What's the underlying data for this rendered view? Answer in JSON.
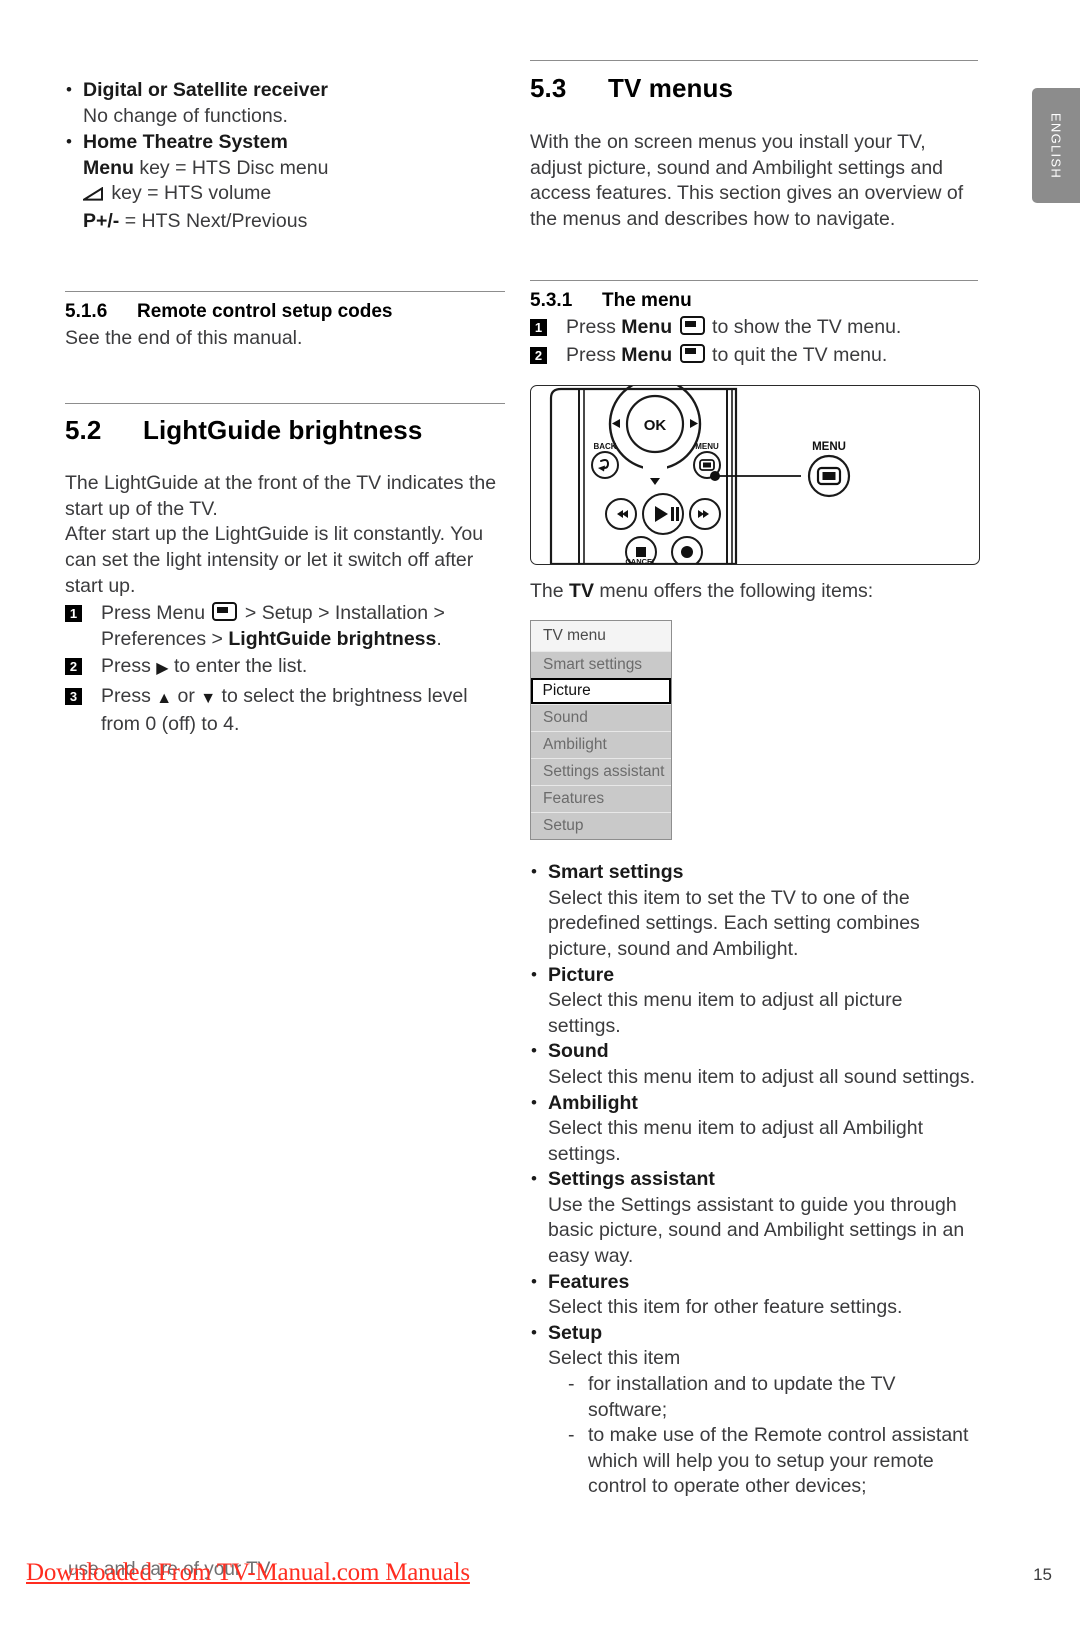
{
  "language_tab": {
    "label": "ENGLISH"
  },
  "left_column": {
    "device_bullets": [
      {
        "term": "Digital or Satellite receiver",
        "lines": [
          "No change of functions."
        ]
      },
      {
        "term": "Home Theatre System",
        "lines": []
      }
    ],
    "hts_lines": [
      {
        "bold": "Menu",
        "rest": " key = HTS Disc menu"
      },
      {
        "icon": "volume-icon",
        "rest": " key = HTS volume"
      },
      {
        "bold": "P+/-",
        "rest": " = HTS Next/Previous"
      }
    ],
    "section_516": {
      "number": "5.1.6",
      "title": "Remote control setup codes",
      "body": "See the end of this manual."
    },
    "section_52": {
      "number": "5.2",
      "title": "LightGuide brightness",
      "paragraphs": [
        "The LightGuide at the front of the TV indicates the start up of the TV.",
        "After start up the LightGuide is lit constantly. You can set the light intensity or let it switch off after start up."
      ],
      "steps": [
        {
          "num": "1",
          "pre": "Press Menu ",
          "post_a": " > Setup > Installation > Preferences > ",
          "bold_tail": "LightGuide brightness",
          "post_b": "."
        },
        {
          "num": "2",
          "text_a": "Press ",
          "arrow": "▶",
          "text_b": " to enter the list."
        },
        {
          "num": "3",
          "text_a": "Press ",
          "arrow_up": "▲",
          "text_mid": " or ",
          "arrow_down": "▼",
          "text_b": " to select the brightness level from 0 (off) to 4."
        }
      ]
    }
  },
  "right_column": {
    "section_53": {
      "number": "5.3",
      "title": "TV menus",
      "intro": "With the on screen menus you install your TV, adjust picture, sound and Ambilight settings and access features. This section gives an overview of the menus and describes how to navigate."
    },
    "section_531": {
      "number": "5.3.1",
      "title": "The menu",
      "steps": [
        {
          "num": "1",
          "pre": "Press ",
          "bold": "Menu",
          "post": " to show the TV menu."
        },
        {
          "num": "2",
          "pre": "Press ",
          "bold": "Menu",
          "post": " to quit the TV menu."
        }
      ]
    },
    "remote_figure": {
      "ok_label": "OK",
      "back_label": "BACK",
      "menu_label": "MENU",
      "callout_label": "MENU",
      "cancel_label": "CANCEL"
    },
    "menu_intro_pre": "The ",
    "menu_intro_bold": "TV",
    "menu_intro_post": " menu offers the following items:",
    "tv_menu": {
      "title": "TV menu",
      "items": [
        {
          "label": "Smart settings",
          "selected": false
        },
        {
          "label": "Picture",
          "selected": true
        },
        {
          "label": "Sound",
          "selected": false
        },
        {
          "label": "Ambilight",
          "selected": false
        },
        {
          "label": "Settings assistant",
          "selected": false
        },
        {
          "label": "Features",
          "selected": false
        },
        {
          "label": "Setup",
          "selected": false
        }
      ]
    },
    "item_descriptions": [
      {
        "term": "Smart settings",
        "body": "Select this item to set the TV to one of the predefined settings. Each setting combines picture, sound and Ambilight."
      },
      {
        "term": "Picture",
        "body": "Select this menu item to adjust all picture settings."
      },
      {
        "term": "Sound",
        "body": "Select this menu item to adjust all sound settings."
      },
      {
        "term": "Ambilight",
        "body": "Select this menu item to adjust all Ambilight settings."
      },
      {
        "term": "Settings assistant",
        "body": "Use the Settings assistant to guide you through basic picture, sound and Ambilight settings in an easy way."
      },
      {
        "term": "Features",
        "body": "Select this item for other feature settings."
      },
      {
        "term": "Setup",
        "body": "Select this item",
        "sub_items": [
          "for installation and to update the TV software;",
          "to make use of the Remote control assistant which will help you to setup your remote control to operate other devices;"
        ]
      }
    ]
  },
  "footer": {
    "page_number": "15",
    "grey_text": "use and care of your TV",
    "watermark": "Downloaded From TV-Manual.com Manuals"
  },
  "colors": {
    "tab_grey": "#8c8c8c",
    "menu_row_grey": "#c9c9c9",
    "watermark_red": "#ff2d20"
  }
}
